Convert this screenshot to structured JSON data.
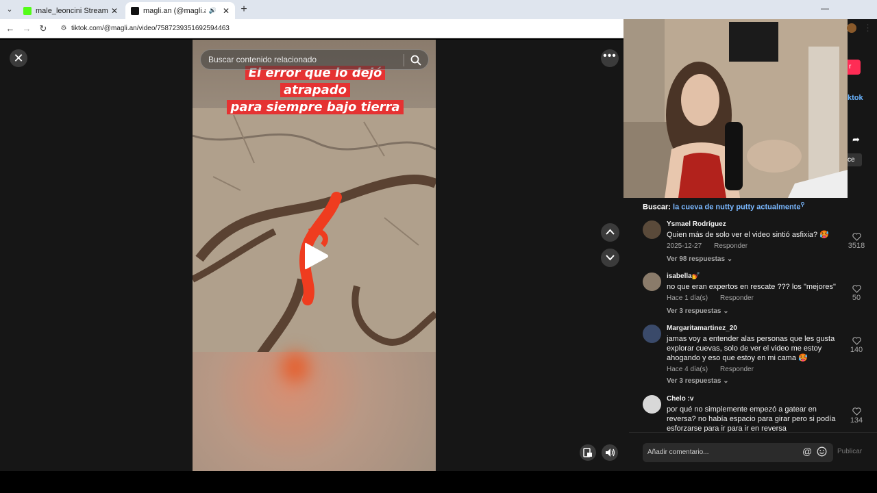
{
  "browser": {
    "tabs": [
      {
        "title": "male_leoncini Stream - Watch L",
        "active": false,
        "favicon_color": "#53fc18"
      },
      {
        "title": "magli.an (@magli.an) | TikTo",
        "active": true,
        "favicon_color": "#111111"
      }
    ],
    "url": "tiktok.com/@magli.an/video/7587239351692594463",
    "icons": {
      "back": "back-arrow-icon",
      "forward": "forward-arrow-icon",
      "reload": "reload-icon",
      "site_info": "site-info-icon"
    }
  },
  "video": {
    "search_placeholder": "Buscar contenido relacionado",
    "caption_line1": "El error que lo dejó atrapado",
    "caption_line2": "para siempre bajo tierra",
    "state": "paused"
  },
  "sidebar": {
    "related_prefix": "Buscar:",
    "related_query": "la cueva de nutty putty actualmente",
    "tiktok_text_peek": "ktok",
    "ce_peek": "ce",
    "accent_color": "#fe2c55"
  },
  "comments": [
    {
      "user": "Ysmael Rodríguez",
      "text": "Quien más de solo ver el video sintió asfixia? 🥵",
      "date": "2025-12-27",
      "reply_label": "Responder",
      "replies_label": "Ver 98 respuestas",
      "likes": "3518",
      "avatar_color": "#5a4a3a"
    },
    {
      "user": "isabella💅",
      "text": "no que eran expertos en rescate ??? los \"mejores\"",
      "date": "Hace 1 día(s)",
      "reply_label": "Responder",
      "replies_label": "Ver 3 respuestas",
      "likes": "50",
      "avatar_color": "#8a7b6a"
    },
    {
      "user": "Margaritamartinez_20",
      "text": "jamas voy a entender alas personas que les gusta explorar cuevas, solo de ver el video me estoy ahogando y eso que estoy en mi cama 🥵",
      "date": "Hace 4 día(s)",
      "reply_label": "Responder",
      "replies_label": "Ver 3 respuestas",
      "likes": "140",
      "avatar_color": "#3a4a6a"
    },
    {
      "user": "Chelo :v",
      "text": "por qué no simplemente empezó a gatear en reversa? no había espacio para girar pero si podía esforzarse para ir para ir en reversa",
      "likes": "134",
      "avatar_color": "#d8d8d8"
    }
  ],
  "compose": {
    "placeholder": "Añadir comentario...",
    "at_symbol": "@",
    "post_label": "Publicar"
  }
}
